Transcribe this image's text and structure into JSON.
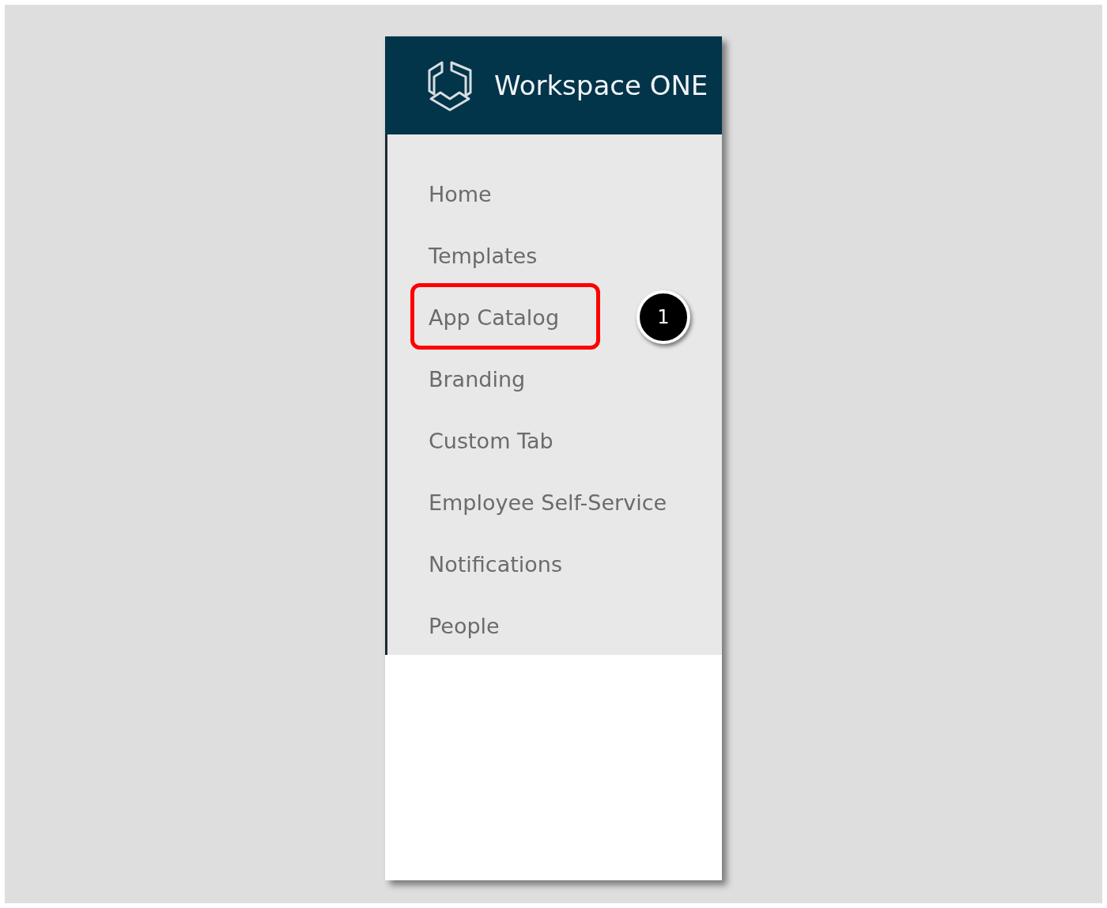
{
  "header": {
    "title": "Workspace ONE"
  },
  "menu": [
    {
      "label": "Home",
      "highlighted": false
    },
    {
      "label": "Templates",
      "highlighted": false
    },
    {
      "label": "App Catalog",
      "highlighted": true,
      "callout": "1"
    },
    {
      "label": "Branding",
      "highlighted": false
    },
    {
      "label": "Custom Tab",
      "highlighted": false
    },
    {
      "label": "Employee Self-Service",
      "highlighted": false
    },
    {
      "label": "Notifications",
      "highlighted": false
    },
    {
      "label": "People",
      "highlighted": false
    }
  ]
}
